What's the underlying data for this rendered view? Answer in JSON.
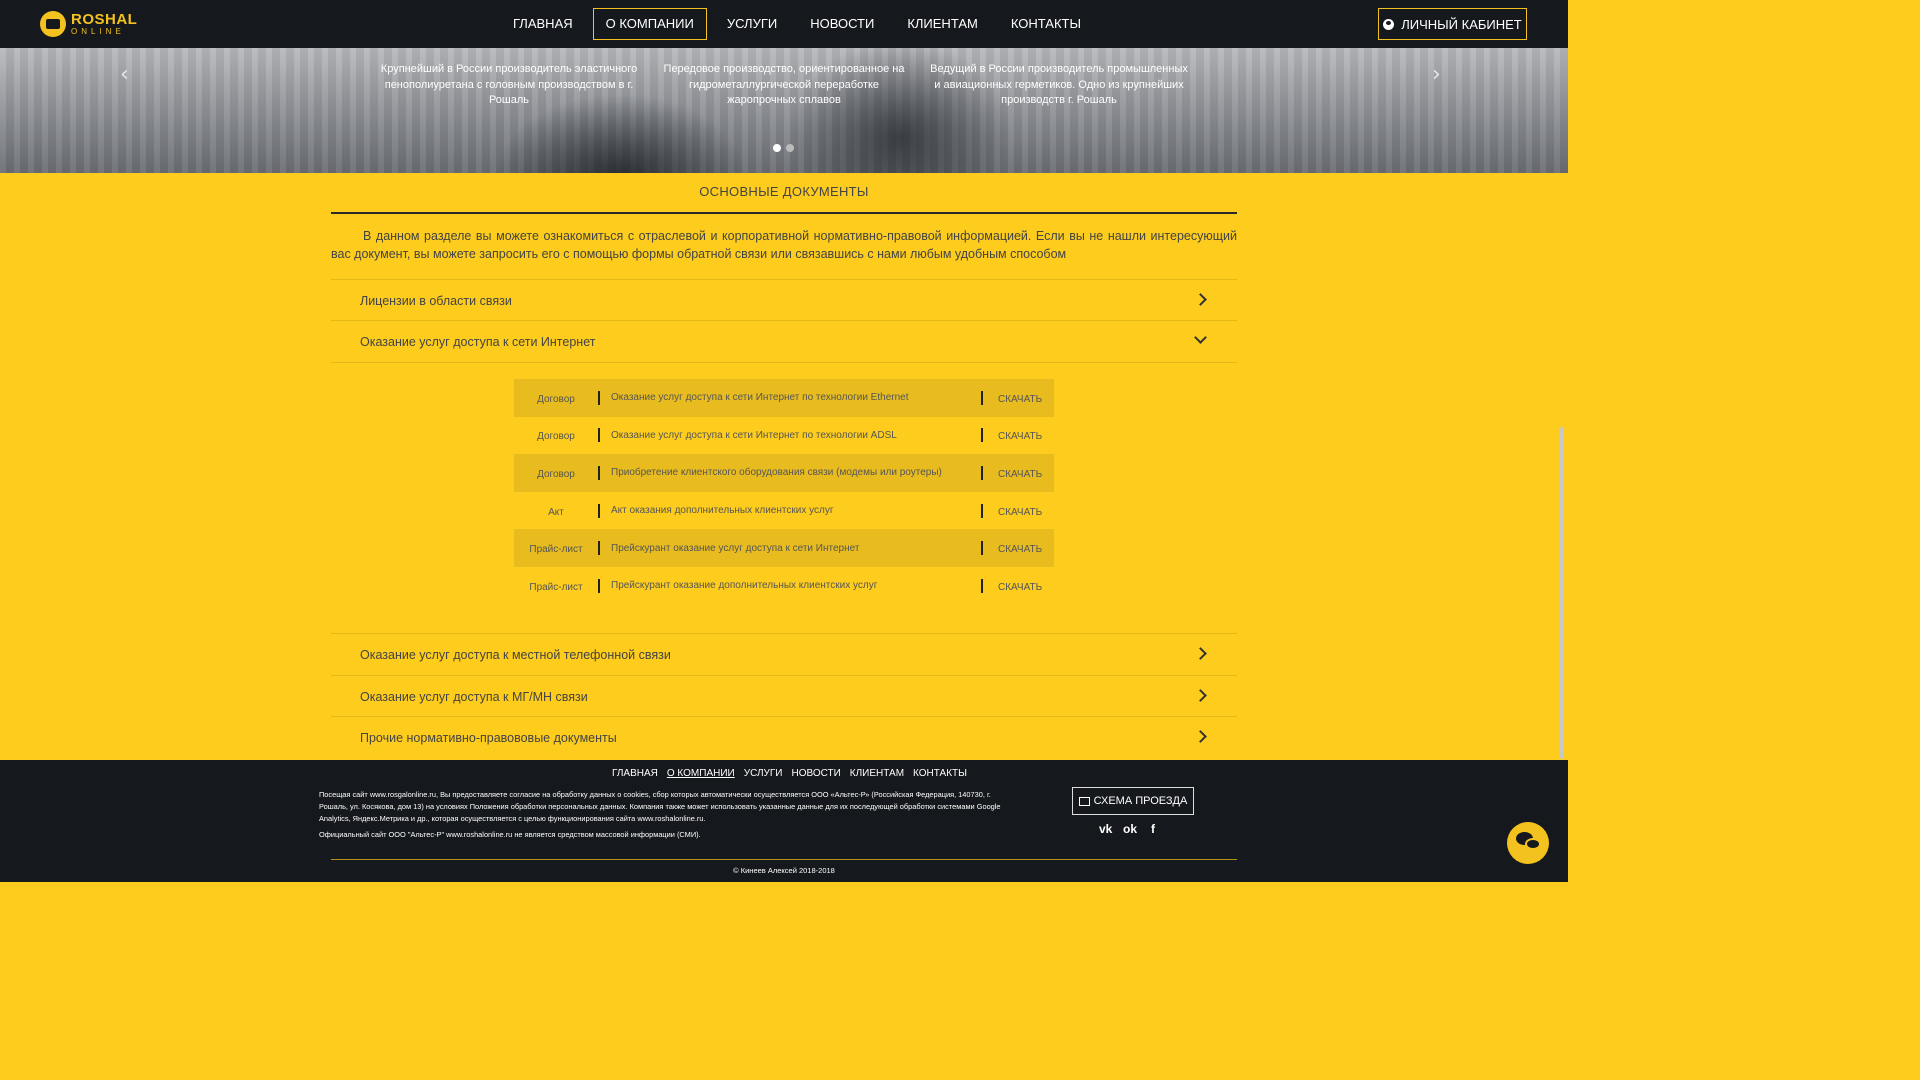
{
  "header": {
    "logo_line1": "ROSHAL",
    "logo_line2": "ONLINE",
    "nav": [
      "ГЛАВНАЯ",
      "О КОМПАНИИ",
      "УСЛУГИ",
      "НОВОСТИ",
      "КЛИЕНТАМ",
      "КОНТАКТЫ"
    ],
    "active_nav": "О КОМПАНИИ",
    "cabinet_label": "ЛИЧНЫЙ КАБИНЕТ"
  },
  "hero": {
    "prev_arrow": "‹",
    "next_arrow": "›",
    "slides": [
      "Крупнейший в России производитель эластичного пенополиуретана с головным производством в г. Рошаль",
      "Передовое производство, ориентированное на гидрометаллургической переработке жаропрочных сплавов",
      "Ведущий в России производитель промышленных и авиационных герметиков. Одно из крупнейших производств г. Рошаль"
    ],
    "dots_count": 2,
    "active_dot": 1
  },
  "main": {
    "section_title": "ОСНОВНЫЕ ДОКУМЕНТЫ",
    "intro": "В данном разделе вы можете ознакомиться с отраслевой и корпоративной нормативно-правовой информацией. Если вы не нашли интересующий вас документ, вы можете запросить его с помощью формы обратной связи или связавшись с нами любым удобным способом",
    "accordion": [
      {
        "label": "Лицензии в области связи",
        "expanded": false
      },
      {
        "label": "Оказание услуг доступа к сети Интернет",
        "expanded": true
      },
      {
        "label": "Оказание услуг доступа к местной телефонной связи",
        "expanded": false
      },
      {
        "label": "Оказание услуг доступа к МГ/МН связи",
        "expanded": false
      },
      {
        "label": "Прочие нормативно-правововые документы",
        "expanded": false
      }
    ],
    "documents": [
      {
        "type": "Договор",
        "name": "Оказание услуг доступа к сети Интернет по технологии Ethernet",
        "action": "СКАЧАТЬ"
      },
      {
        "type": "Договор",
        "name": "Оказание услуг доступа к сети Интернет по технологии ADSL",
        "action": "СКАЧАТЬ"
      },
      {
        "type": "Договор",
        "name": "Приобретение клиентского оборудования связи (модемы или роутеры)",
        "action": "СКАЧАТЬ"
      },
      {
        "type": "Акт",
        "name": "Акт оказания дополнительных клиентских услуг",
        "action": "СКАЧАТЬ"
      },
      {
        "type": "Прайс-лист",
        "name": "Прейскурант оказание услуг доступа к сети Интернет",
        "action": "СКАЧАТЬ"
      },
      {
        "type": "Прайс-лист",
        "name": "Прейскурант оказание дополнительных клиентских услуг",
        "action": "СКАЧАТЬ"
      }
    ]
  },
  "footer": {
    "nav": [
      "ГЛАВНАЯ",
      "О КОМПАНИИ",
      "УСЛУГИ",
      "НОВОСТИ",
      "КЛИЕНТАМ",
      "КОНТАКТЫ"
    ],
    "legal": "Посещая сайт www.rosgalonline.ru, Вы предоставляете согласие на обработку данных о cookies, сбор которых автоматически осуществляется ООО «Альтес-Р» (Российская Федерация, 140730, г. Рошаль, ул. Косякова, дом 13) на условиях Положения обработки персональных данных. Компания также может использовать указанные данные для их последующей обработки системами Google Analytics, Яндекс.Метрика и др., которая осуществляется с целью функционирования сайта www.roshalonline.ru.",
    "legal2": "Официальный сайт ООО \"Альтес-Р\" www.roshalonline.ru не является средством массовой информации (СМИ).",
    "route_label": "СХЕМА ПРОЕЗДА",
    "socials": [
      "vk-icon",
      "odnoklassniki-icon",
      "facebook-icon"
    ],
    "social_glyphs": [
      "vk",
      "ok",
      "f"
    ],
    "copyright": "© Кинеев Алексей 2018-2018"
  },
  "colors": {
    "accent": "#fdcc1d",
    "dark": "#15181c",
    "row_highlight": "#e8bc1f"
  }
}
